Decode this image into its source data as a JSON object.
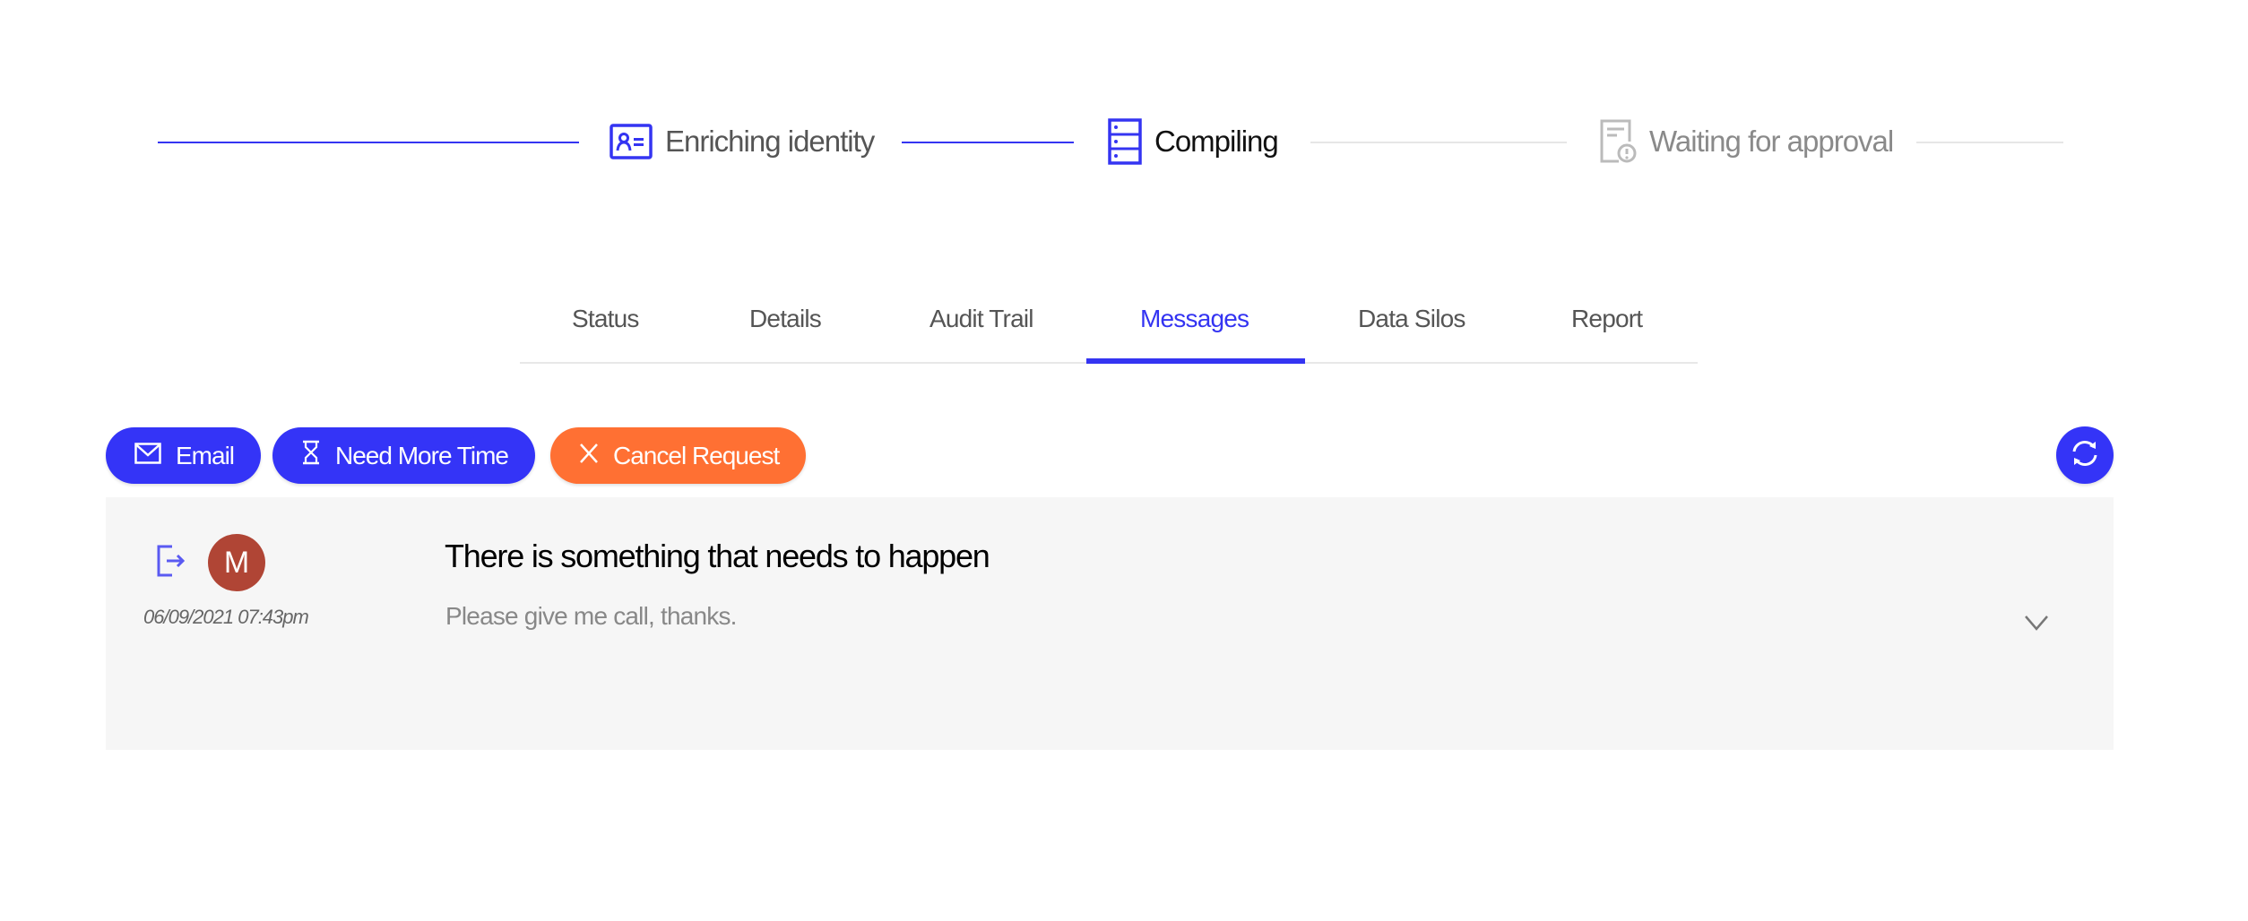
{
  "stepper": {
    "steps": [
      {
        "label": "Enriching identity",
        "icon": "id-card-icon",
        "state": "done"
      },
      {
        "label": "Compiling",
        "icon": "server-stack-icon",
        "state": "current"
      },
      {
        "label": "Waiting for approval",
        "icon": "document-alert-icon",
        "state": "pending"
      }
    ]
  },
  "tabs": [
    {
      "label": "Status"
    },
    {
      "label": "Details"
    },
    {
      "label": "Audit Trail"
    },
    {
      "label": "Messages",
      "active": true
    },
    {
      "label": "Data Silos"
    },
    {
      "label": "Report"
    }
  ],
  "actions": {
    "email_label": "Email",
    "more_time_label": "Need More Time",
    "cancel_label": "Cancel Request",
    "refresh_icon": "refresh-icon"
  },
  "colors": {
    "accent": "#3434f7",
    "danger": "#ff7033",
    "avatar": "#b04535"
  },
  "messages": [
    {
      "direction_icon": "outgoing-icon",
      "avatar_initial": "M",
      "timestamp": "06/09/2021 07:43pm",
      "subject": "There is something that needs to happen",
      "preview": "Please give me call, thanks."
    }
  ]
}
